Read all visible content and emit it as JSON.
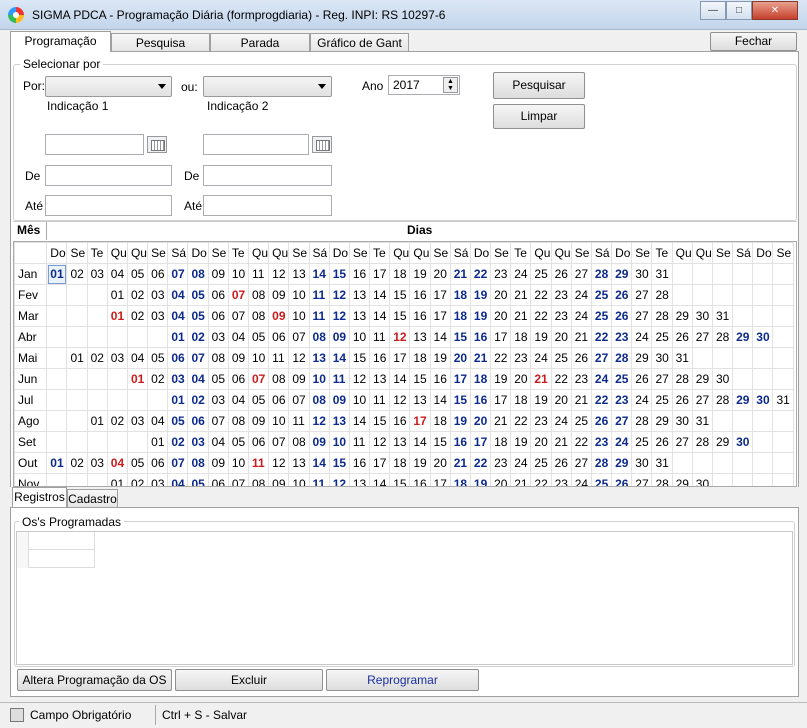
{
  "window": {
    "title": "SIGMA PDCA - Programação Diária  (formprogdiaria)  - Reg. INPI: RS 10297-6",
    "minimize": "—",
    "maximize": "□",
    "close": "✕"
  },
  "tabs": [
    "Programação",
    "Pesquisa",
    "Parada",
    "Gráfico de Gant"
  ],
  "close_button": "Fechar",
  "filter": {
    "group_title": "Selecionar por",
    "por_label": "Por:",
    "ou_label": "ou:",
    "indicacao1": "Indicação 1",
    "indicacao2": "Indicação 2",
    "ano_label": "Ano",
    "ano_value": "2017",
    "de_label": "De",
    "ate_label": "Até",
    "pesquisar": "Pesquisar",
    "limpar": "Limpar"
  },
  "calendar": {
    "mes_label": "Mês",
    "dias_label": "Dias",
    "weekday_headers": [
      "Do",
      "Se",
      "Te",
      "Qu",
      "Qu",
      "Se",
      "Sá",
      "Do",
      "Se",
      "Te",
      "Qu",
      "Qu",
      "Se",
      "Sá",
      "Do",
      "Se",
      "Te",
      "Qu",
      "Qu",
      "Se",
      "Sá",
      "Do",
      "Se",
      "Te",
      "Qu",
      "Qu",
      "Se",
      "Sá",
      "Do",
      "Se",
      "Te",
      "Qu",
      "Qu",
      "Se",
      "Sá",
      "Do",
      "Se"
    ],
    "months": [
      {
        "name": "Jan",
        "offset": 0,
        "days": 31,
        "red": [],
        "selected": 1
      },
      {
        "name": "Fev",
        "offset": 3,
        "days": 28,
        "red": [
          7
        ]
      },
      {
        "name": "Mar",
        "offset": 3,
        "days": 31,
        "red": [
          1,
          9
        ]
      },
      {
        "name": "Abr",
        "offset": 6,
        "days": 30,
        "red": [
          12
        ]
      },
      {
        "name": "Mai",
        "offset": 1,
        "days": 31,
        "red": []
      },
      {
        "name": "Jun",
        "offset": 4,
        "days": 30,
        "red": [
          1,
          7,
          21
        ]
      },
      {
        "name": "Jul",
        "offset": 6,
        "days": 31,
        "red": []
      },
      {
        "name": "Ago",
        "offset": 2,
        "days": 31,
        "red": [
          17
        ]
      },
      {
        "name": "Set",
        "offset": 5,
        "days": 30,
        "red": []
      },
      {
        "name": "Out",
        "offset": 0,
        "days": 31,
        "red": [
          4,
          11
        ]
      },
      {
        "name": "Nov",
        "offset": 3,
        "days": 30,
        "red": []
      }
    ],
    "highlight_colors": {
      "weekend": "#0c2a8c",
      "event": "#cc1b1b"
    }
  },
  "lower_tabs": [
    "Registros",
    "Cadastro"
  ],
  "os_group_title": "Os's Programadas",
  "actions": {
    "altera": "Altera Programação da OS",
    "excluir": "Excluir",
    "reprogramar": "Reprogramar"
  },
  "status": {
    "required": "Campo Obrigatório",
    "shortcut": "Ctrl + S - Salvar"
  }
}
